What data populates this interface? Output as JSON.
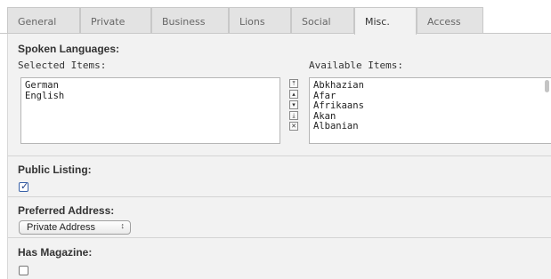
{
  "tabs": [
    {
      "label": "General",
      "active": false
    },
    {
      "label": "Private",
      "active": false
    },
    {
      "label": "Business",
      "active": false
    },
    {
      "label": "Lions",
      "active": false
    },
    {
      "label": "Social",
      "active": false
    },
    {
      "label": "Misc.",
      "active": true
    },
    {
      "label": "Access",
      "active": false
    }
  ],
  "spoken_languages": {
    "title": "Spoken Languages:",
    "selected_label": "Selected Items:",
    "available_label": "Available Items:",
    "selected_items": [
      "German",
      "English"
    ],
    "available_items": [
      "Abkhazian",
      "Afar",
      "Afrikaans",
      "Akan",
      "Albanian"
    ],
    "controls": [
      {
        "name": "move-top",
        "glyph": "⤒"
      },
      {
        "name": "move-up",
        "glyph": "▴"
      },
      {
        "name": "move-down",
        "glyph": "▾"
      },
      {
        "name": "move-bottom",
        "glyph": "⤓"
      },
      {
        "name": "remove",
        "glyph": "✕"
      }
    ]
  },
  "public_listing": {
    "title": "Public Listing:",
    "checked": true
  },
  "preferred_address": {
    "title": "Preferred Address:",
    "selected": "Private Address",
    "arrow": "↕"
  },
  "has_magazine": {
    "title": "Has Magazine:",
    "checked": false
  },
  "colors": {
    "panel": "#f2f2f2",
    "tab": "#e3e3e3",
    "border": "#c8c8c8",
    "check": "#1e3f86"
  }
}
